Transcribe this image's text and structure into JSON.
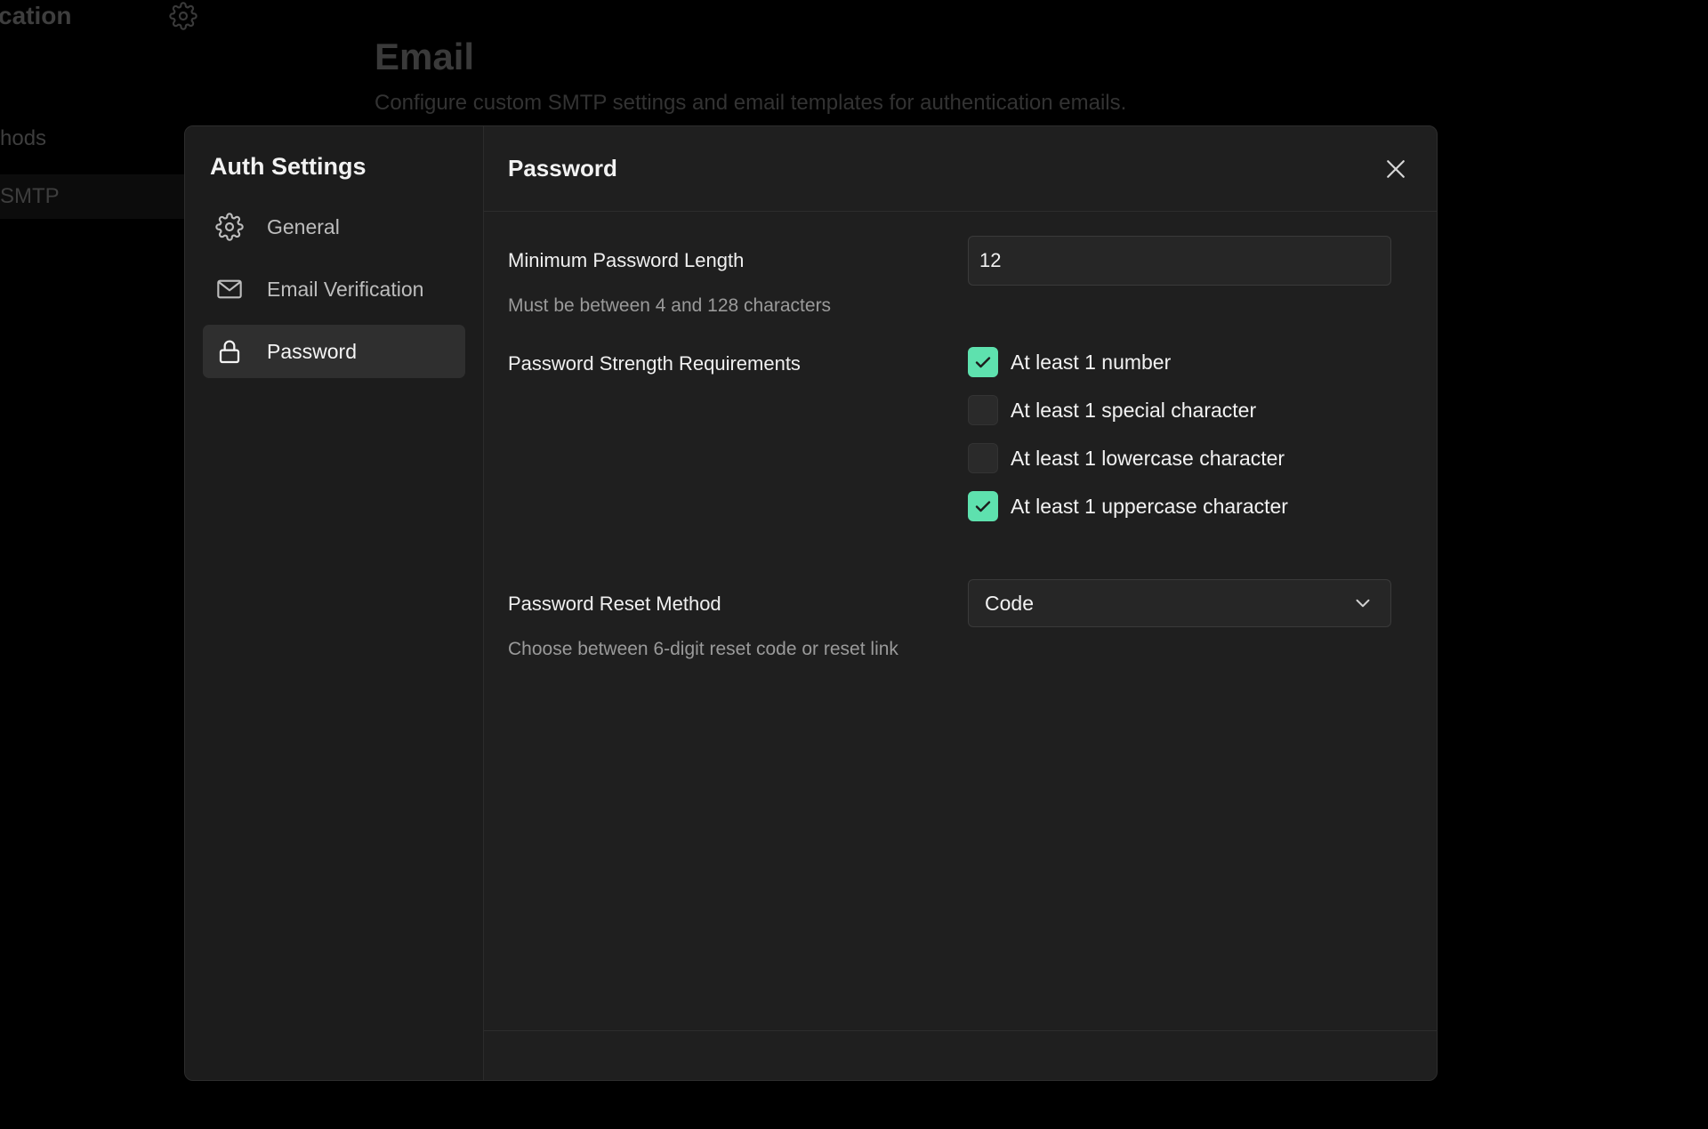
{
  "background": {
    "sidebar_title": "cation",
    "nav_item_1": "hods",
    "nav_item_2": "SMTP",
    "page_title": "Email",
    "page_subtitle": "Configure custom SMTP settings and email templates for authentication emails."
  },
  "modal": {
    "sidebar_title": "Auth Settings",
    "nav": [
      {
        "label": "General",
        "icon": "gear-icon",
        "active": false
      },
      {
        "label": "Email Verification",
        "icon": "mail-icon",
        "active": false
      },
      {
        "label": "Password",
        "icon": "lock-icon",
        "active": true
      }
    ],
    "title": "Password",
    "min_length": {
      "label": "Minimum Password Length",
      "help": "Must be between 4 and 128 characters",
      "value": "12"
    },
    "strength": {
      "label": "Password Strength Requirements",
      "options": [
        {
          "label": "At least 1 number",
          "checked": true
        },
        {
          "label": "At least 1 special character",
          "checked": false
        },
        {
          "label": "At least 1 lowercase character",
          "checked": false
        },
        {
          "label": "At least 1 uppercase character",
          "checked": true
        }
      ]
    },
    "reset_method": {
      "label": "Password Reset Method",
      "help": "Choose between 6-digit reset code or reset link",
      "value": "Code"
    }
  },
  "colors": {
    "accent": "#5ee1ae",
    "modal_bg": "#1f1f1f",
    "page_bg": "#000000"
  }
}
